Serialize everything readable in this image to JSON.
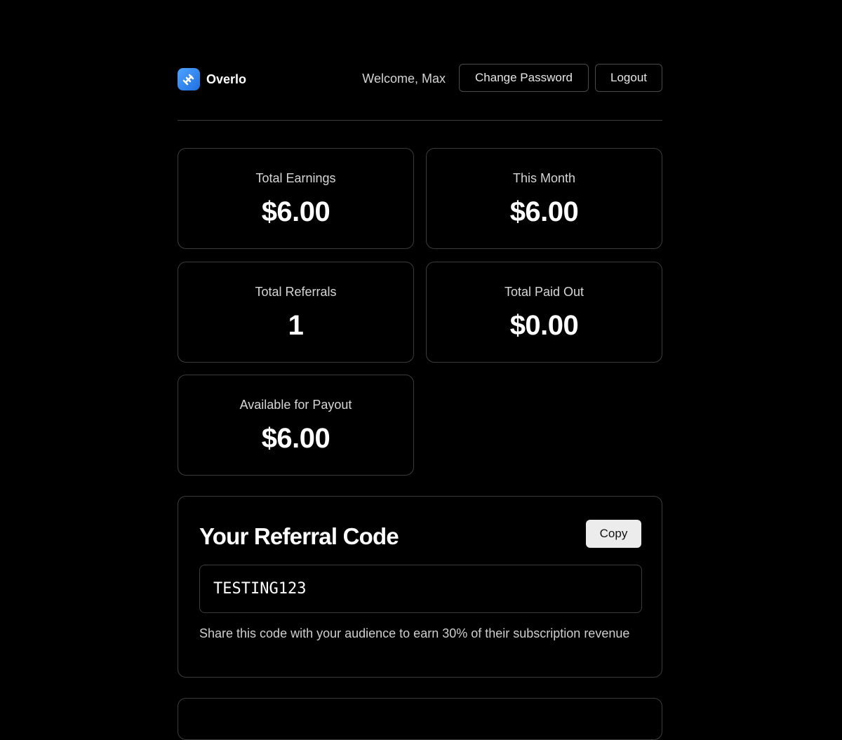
{
  "header": {
    "brand": "Overlo",
    "logo_icon": "overlo-logo-icon",
    "welcome": "Welcome, Max",
    "change_password_label": "Change Password",
    "logout_label": "Logout"
  },
  "stats": [
    {
      "label": "Total Earnings",
      "value": "$6.00"
    },
    {
      "label": "This Month",
      "value": "$6.00"
    },
    {
      "label": "Total Referrals",
      "value": "1"
    },
    {
      "label": "Total Paid Out",
      "value": "$0.00"
    },
    {
      "label": "Available for Payout",
      "value": "$6.00"
    }
  ],
  "referral": {
    "title": "Your Referral Code",
    "copy_label": "Copy",
    "code": "TESTING123",
    "hint": "Share this code with your audience to earn 30% of their subscription revenue"
  },
  "colors": {
    "background": "#000000",
    "border": "#3c3c3c",
    "accent": "#2f86f5",
    "copy_button": "#ececec"
  }
}
